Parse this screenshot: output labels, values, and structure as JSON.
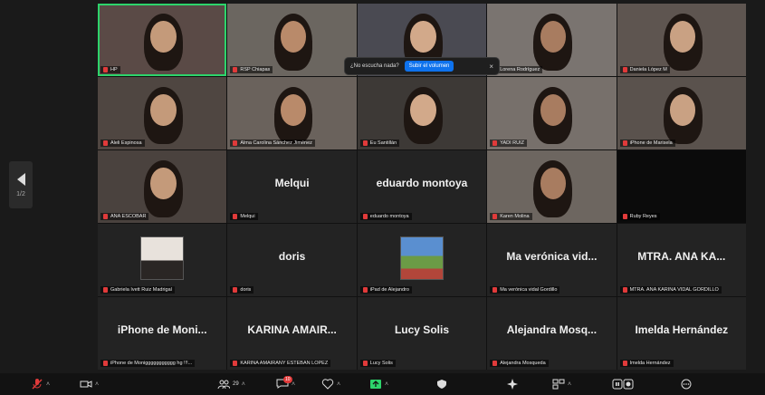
{
  "sidebar": {
    "page_indicator": "1/2"
  },
  "popup": {
    "message": "¿No escucha nada?",
    "button_label": "Subir el volumen",
    "close_glyph": "×"
  },
  "tiles": [
    {
      "caption": "HP",
      "active": true,
      "video": true
    },
    {
      "caption": "RSP Chiapas",
      "video": true
    },
    {
      "caption": "",
      "video": true
    },
    {
      "caption": "Lorena Rodríguez",
      "video": true
    },
    {
      "caption": "Daniela López M",
      "video": true
    },
    {
      "caption": "Aleli Espinosa",
      "video": true
    },
    {
      "caption": "Alma Carolina Sánchez Jiménez",
      "video": true
    },
    {
      "caption": "Eu Santillán",
      "video": true
    },
    {
      "caption": "YADI RUIZ",
      "video": true
    },
    {
      "caption": "iPhone de Marisela",
      "video": true
    },
    {
      "caption": "ANA ESCOBAR",
      "video": true
    },
    {
      "caption": "Melqui",
      "name": "Melqui"
    },
    {
      "caption": "eduardo montoya",
      "name": "eduardo montoya"
    },
    {
      "caption": "Karen Molina",
      "video": true
    },
    {
      "caption": "Ruby Reyes"
    },
    {
      "caption": "Gabriela Ivett Ruiz Madrigal",
      "avatar": "photo"
    },
    {
      "caption": "doris",
      "name": "doris"
    },
    {
      "caption": "iPad de Alejandro",
      "avatar": "landscape"
    },
    {
      "caption": "Ma verónica vidal Gordillo",
      "name": "Ma verónica vid..."
    },
    {
      "caption": "MTRA. ANA KARINA VIDAL GORDILLO",
      "name": "MTRA. ANA KA..."
    },
    {
      "caption": "iPhone de Moniggggggggggg hg !!!...",
      "name": "iPhone de Moni..."
    },
    {
      "caption": "KARINA AMAIRANY ESTEBAN LOPEZ",
      "name": "KARINA AMAIR..."
    },
    {
      "caption": "Lucy Solis",
      "name": "Lucy Solis"
    },
    {
      "caption": "Alejandra Mosqueda",
      "name": "Alejandra Mosq..."
    },
    {
      "caption": "Imelda Hernández",
      "name": "Imelda Hernández"
    }
  ],
  "toolbar": {
    "participants_count": "29",
    "chat_badge": "10"
  },
  "colors": {
    "active_border": "#2dd46b",
    "mute": "#e03a3a",
    "accent": "#0e72ed"
  }
}
